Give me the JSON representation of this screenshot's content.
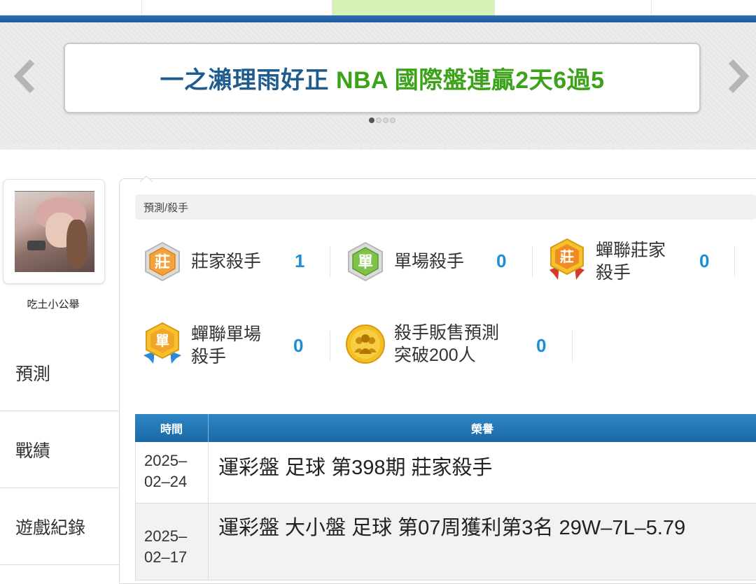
{
  "banner": {
    "title_part1": "一之瀨理雨好正",
    "title_part2": "NBA 國際盤連贏2天6過5",
    "prev_icon": "chevron-left-icon",
    "next_icon": "chevron-right-icon",
    "slides": 4,
    "active_slide": 1
  },
  "profile": {
    "username": "吃土小公舉"
  },
  "sidebar": {
    "items": [
      {
        "label": "預測"
      },
      {
        "label": "戰績"
      },
      {
        "label": "遊戲紀錄"
      }
    ]
  },
  "main": {
    "breadcrumb": "預測/殺手",
    "stats": [
      {
        "icon": "banker-badge-icon",
        "label": "莊家殺手",
        "value": "1"
      },
      {
        "icon": "single-badge-icon",
        "label": "單場殺手",
        "value": "0"
      },
      {
        "icon": "league-banker-badge-icon",
        "label": "蟬聯莊家殺手",
        "label_line1": "蟬聯莊家",
        "label_line2": "殺手",
        "value": "0"
      },
      {
        "icon": "league-single-badge-icon",
        "label": "蟬聯單場殺手",
        "label_line1": "蟬聯單場",
        "label_line2": "殺手",
        "value": "0"
      },
      {
        "icon": "sales-badge-icon",
        "label": "殺手販售預測突破200人",
        "label_line1": "殺手販售預測",
        "label_line2": "突破200人",
        "value": "0"
      }
    ],
    "table": {
      "headers": {
        "time": "時間",
        "honor": "榮譽"
      },
      "rows": [
        {
          "date_line1": "2025–",
          "date_line2": "02–24",
          "honor": "運彩盤 足球 第398期 莊家殺手"
        },
        {
          "date_line1": "2025–",
          "date_line2": "02–17",
          "honor": "運彩盤 大小盤 足球 第07周獲利第3名 29W–7L–5.79"
        }
      ]
    }
  },
  "colors": {
    "accent_blue": "#1a8fd8",
    "header_blue": "#1a69a6",
    "banner_blue": "#1e5b8f",
    "banner_green": "#3ba21a"
  }
}
